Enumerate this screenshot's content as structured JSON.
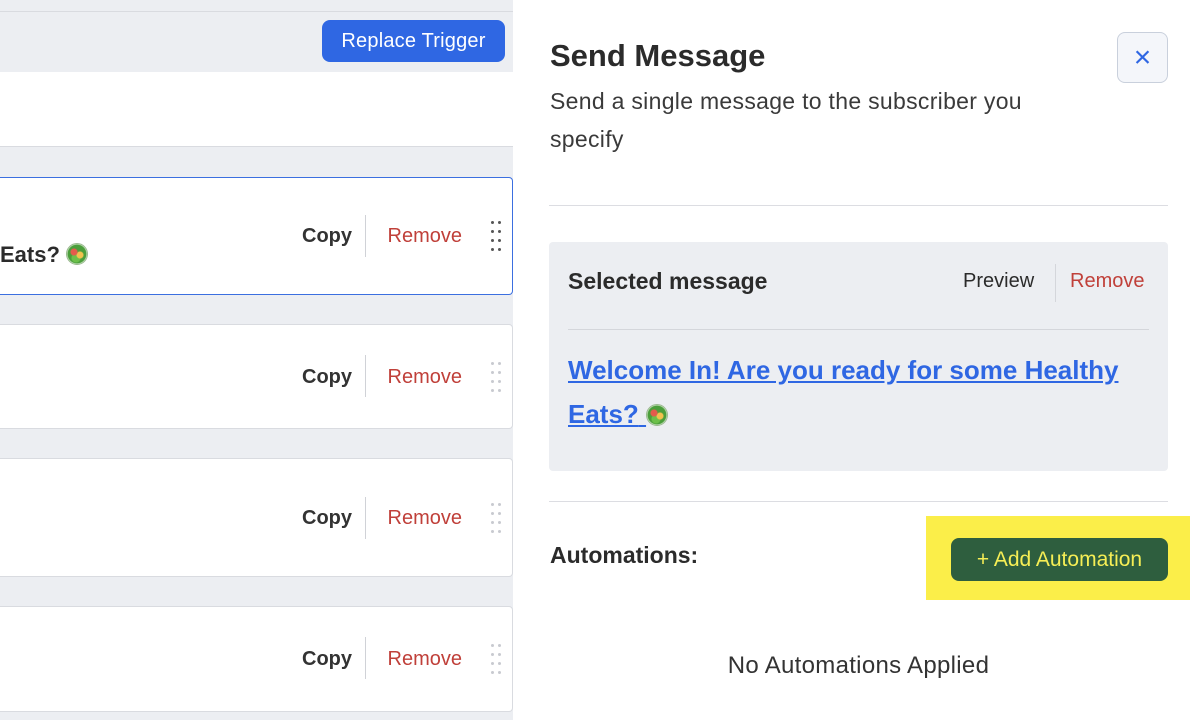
{
  "left_panel": {
    "replace_trigger_label": "Replace Trigger",
    "steps": [
      {
        "text": "Eats?",
        "copy": "Copy",
        "remove": "Remove"
      },
      {
        "text": "",
        "copy": "Copy",
        "remove": "Remove"
      },
      {
        "text": "",
        "copy": "Copy",
        "remove": "Remove"
      },
      {
        "text": "",
        "copy": "Copy",
        "remove": "Remove"
      }
    ]
  },
  "drawer": {
    "title": "Send Message",
    "subtitle": "Send a single message to the subscriber you specify",
    "close_icon": "×",
    "selected_message": {
      "label": "Selected message",
      "preview": "Preview",
      "remove": "Remove",
      "message_title": "Welcome In! Are you ready for some Healthy Eats?"
    },
    "automations": {
      "label": "Automations:",
      "add_button": "+ Add Automation",
      "empty_text": "No Automations Applied"
    }
  },
  "colors": {
    "primary_blue": "#2f67e3",
    "remove_red": "#c0403a",
    "add_button_green": "#2e5e3e",
    "highlight_yellow": "#fbee49"
  }
}
